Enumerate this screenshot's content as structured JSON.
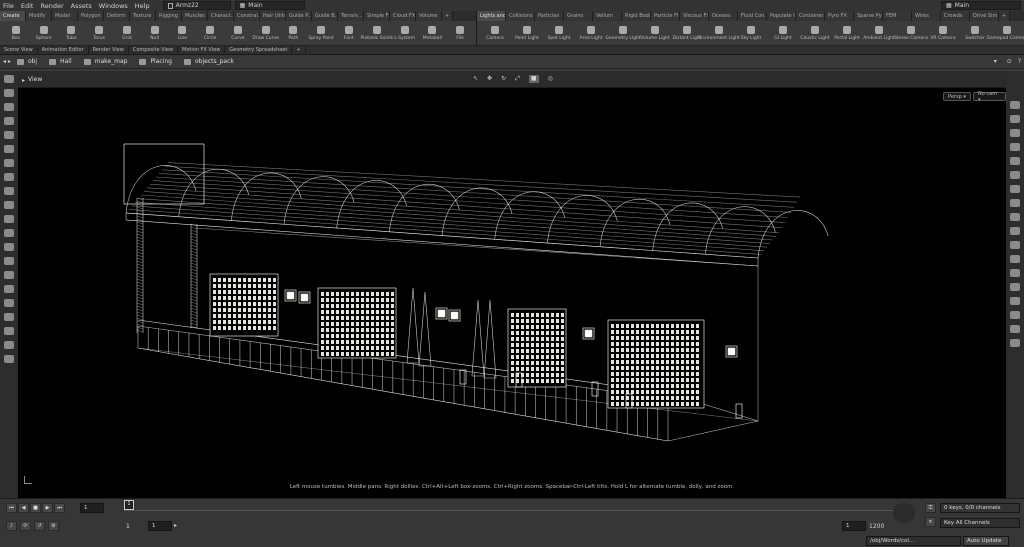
{
  "menu": [
    "File",
    "Edit",
    "Render",
    "Assets",
    "Windows",
    "Help"
  ],
  "scene_file": "Armz22",
  "desktop": "Main",
  "desktop_right": "Main",
  "shelf_left": {
    "tabs": [
      "Create",
      "Modify",
      "Model",
      "Polygon",
      "Deform",
      "Texture",
      "Rigging",
      "Muscles",
      "Charact...",
      "Constrai...",
      "Hair Utils",
      "Guide P...",
      "Guide B...",
      "Terrain...",
      "Simple FX",
      "Cloud FX",
      "Volume"
    ],
    "tools": [
      "Box",
      "Sphere",
      "Tube",
      "Torus",
      "Grid",
      "Null",
      "Line",
      "Circle",
      "Curve",
      "Draw Curve",
      "Path",
      "Spray Paint",
      "Font",
      "Platonic Solids",
      "L-System",
      "Metaball",
      "File"
    ]
  },
  "shelf_right": {
    "tabs": [
      "Lights and...",
      "Collisions",
      "Particles",
      "Grains",
      "Vellum",
      "Rigid Bodies",
      "Particle Fl...",
      "Viscous Fl...",
      "Oceans",
      "Fluid Con...",
      "Populate C...",
      "Container...",
      "Pyro FX",
      "Sparse Pyr...",
      "FEM",
      "Wires",
      "Crowds",
      "Drive Sim..."
    ],
    "tools": [
      "Camera",
      "Point Light",
      "Spot Light",
      "Area Light",
      "Geometry Light",
      "Volume Light",
      "Distant Light",
      "Environment Light",
      "Sky Light",
      "GI Light",
      "Caustic Light",
      "Portal Light",
      "Ambient Light",
      "Stereo Camera",
      "VR Camera",
      "Switcher",
      "Gamepad Camera"
    ]
  },
  "pane_tabs": [
    "Scene View",
    "Animation Editor",
    "Render View",
    "Composite View",
    "Motion FX View",
    "Geometry Spreadsheet"
  ],
  "path": [
    "obj",
    "Hall",
    "make_map",
    "Placing",
    "objects_pack"
  ],
  "view_label": "View",
  "persp": "Persp ▾",
  "cam": "No cam ▾",
  "hint": "Left mouse tumbles. Middle pans. Right dollies. Ctrl+Alt+Left box-zooms. Ctrl+Right zooms. Spacebar-Ctrl-Left tilts. Hold L for alternate tumble, dolly, and zoom.",
  "timeline": {
    "current_frame": "1",
    "start": "1",
    "start2": "1",
    "end": "1200",
    "end_frame": "1",
    "marker": "1"
  },
  "channels": {
    "keys": "0 keys, 0/0 channels",
    "key_mode": "Key All Channels"
  },
  "status": {
    "path": "/obj/Words/col...",
    "auto_update": "Auto Update"
  },
  "colors": {
    "wire": "#e4e4dc",
    "bg": "#000000"
  }
}
